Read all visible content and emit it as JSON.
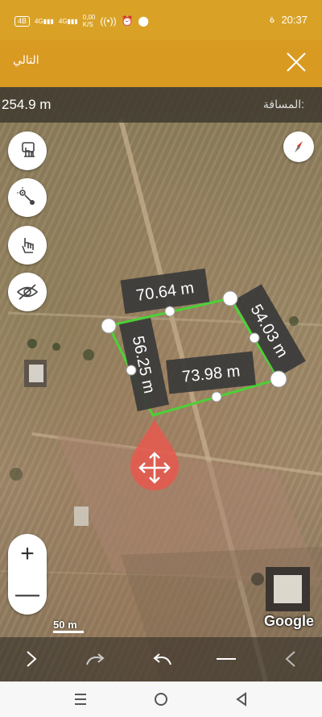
{
  "status_bar": {
    "network_badge": "4B",
    "signal_1": "4G",
    "signal_2": "4G",
    "data_speed": "0,00",
    "data_unit": "K/S",
    "time": "20:37"
  },
  "app_bar": {
    "next_label": "التالي"
  },
  "distance_bar": {
    "value": "254.9 m",
    "label": "المسافة:"
  },
  "measurements": {
    "top": "70.64 m",
    "right": "54.03 m",
    "left": "56.25 m",
    "bottom": "73.98 m"
  },
  "map": {
    "scale_label": "50 m",
    "attribution": "Google"
  },
  "zoom": {
    "in": "+",
    "out": "—"
  },
  "colors": {
    "status_bar": "#d9a227",
    "app_bar": "#d99a22",
    "polygon": "#4cd137",
    "move_marker": "#e8584e"
  },
  "icons": {
    "tool_1": "hand-tap-icon",
    "tool_2": "measure-points-icon",
    "tool_3": "hand-drag-icon",
    "tool_4": "eye-hidden-icon",
    "compass": "compass-icon",
    "move": "move-arrows-icon"
  }
}
